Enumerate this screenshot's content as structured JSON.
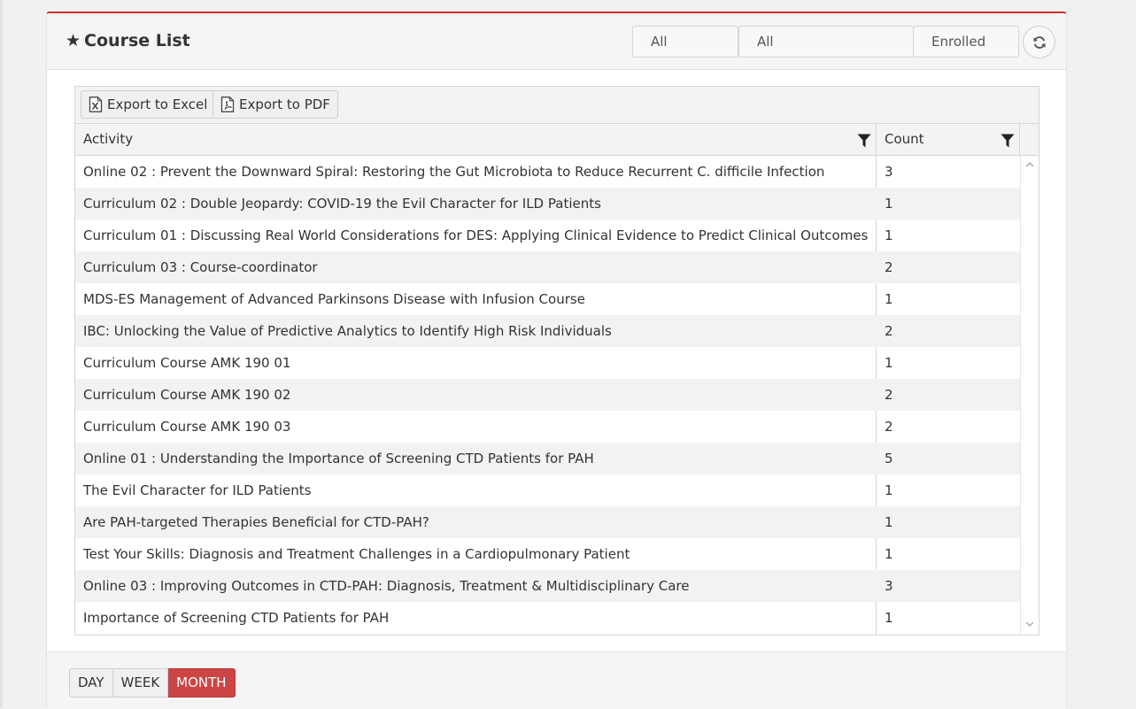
{
  "header": {
    "title": "Course List",
    "filters": [
      {
        "value": "All"
      },
      {
        "value": "All"
      },
      {
        "value": "Enrolled"
      }
    ]
  },
  "toolbar": {
    "export_excel_label": "Export to Excel",
    "export_pdf_label": "Export to PDF"
  },
  "table": {
    "columns": [
      "Activity",
      "Count"
    ],
    "rows": [
      {
        "activity": "Online 02 : Prevent the Downward Spiral: Restoring the Gut Microbiota to Reduce Recurrent C. difficile Infection",
        "count": "3"
      },
      {
        "activity": "Curriculum 02 : Double Jeopardy: COVID-19 the Evil Character for ILD Patients",
        "count": "1"
      },
      {
        "activity": "Curriculum 01 : Discussing Real World Considerations for DES: Applying Clinical Evidence to Predict Clinical Outcomes",
        "count": "1"
      },
      {
        "activity": "Curriculum 03 : Course-coordinator",
        "count": "2"
      },
      {
        "activity": "MDS-ES Management of Advanced Parkinsons Disease with Infusion Course",
        "count": "1"
      },
      {
        "activity": "IBC: Unlocking the Value of Predictive Analytics to Identify High Risk Individuals",
        "count": "2"
      },
      {
        "activity": "Curriculum Course AMK 190 01",
        "count": "1"
      },
      {
        "activity": "Curriculum Course AMK 190 02",
        "count": "2"
      },
      {
        "activity": "Curriculum Course AMK 190 03",
        "count": "2"
      },
      {
        "activity": "Online 01 : Understanding the Importance of Screening CTD Patients for PAH",
        "count": "5"
      },
      {
        "activity": "The Evil Character for ILD Patients",
        "count": "1"
      },
      {
        "activity": "Are PAH-targeted Therapies Beneficial for CTD-PAH?",
        "count": "1"
      },
      {
        "activity": "Test Your Skills: Diagnosis and Treatment Challenges in a Cardiopulmonary Patient",
        "count": "1"
      },
      {
        "activity": "Online 03 : Improving Outcomes in CTD-PAH: Diagnosis, Treatment & Multidisciplinary Care",
        "count": "3"
      },
      {
        "activity": "Importance of Screening CTD Patients for PAH",
        "count": "1"
      }
    ]
  },
  "period": {
    "options": [
      "DAY",
      "WEEK",
      "MONTH"
    ],
    "selected": "MONTH"
  },
  "colors": {
    "accent": "#c9302c",
    "active_button": "#cc4545"
  },
  "icons": {
    "title": "star-icon",
    "refresh": "refresh-icon",
    "excel": "excel-file-icon",
    "pdf": "pdf-file-icon",
    "column_filter": "filter-icon"
  }
}
